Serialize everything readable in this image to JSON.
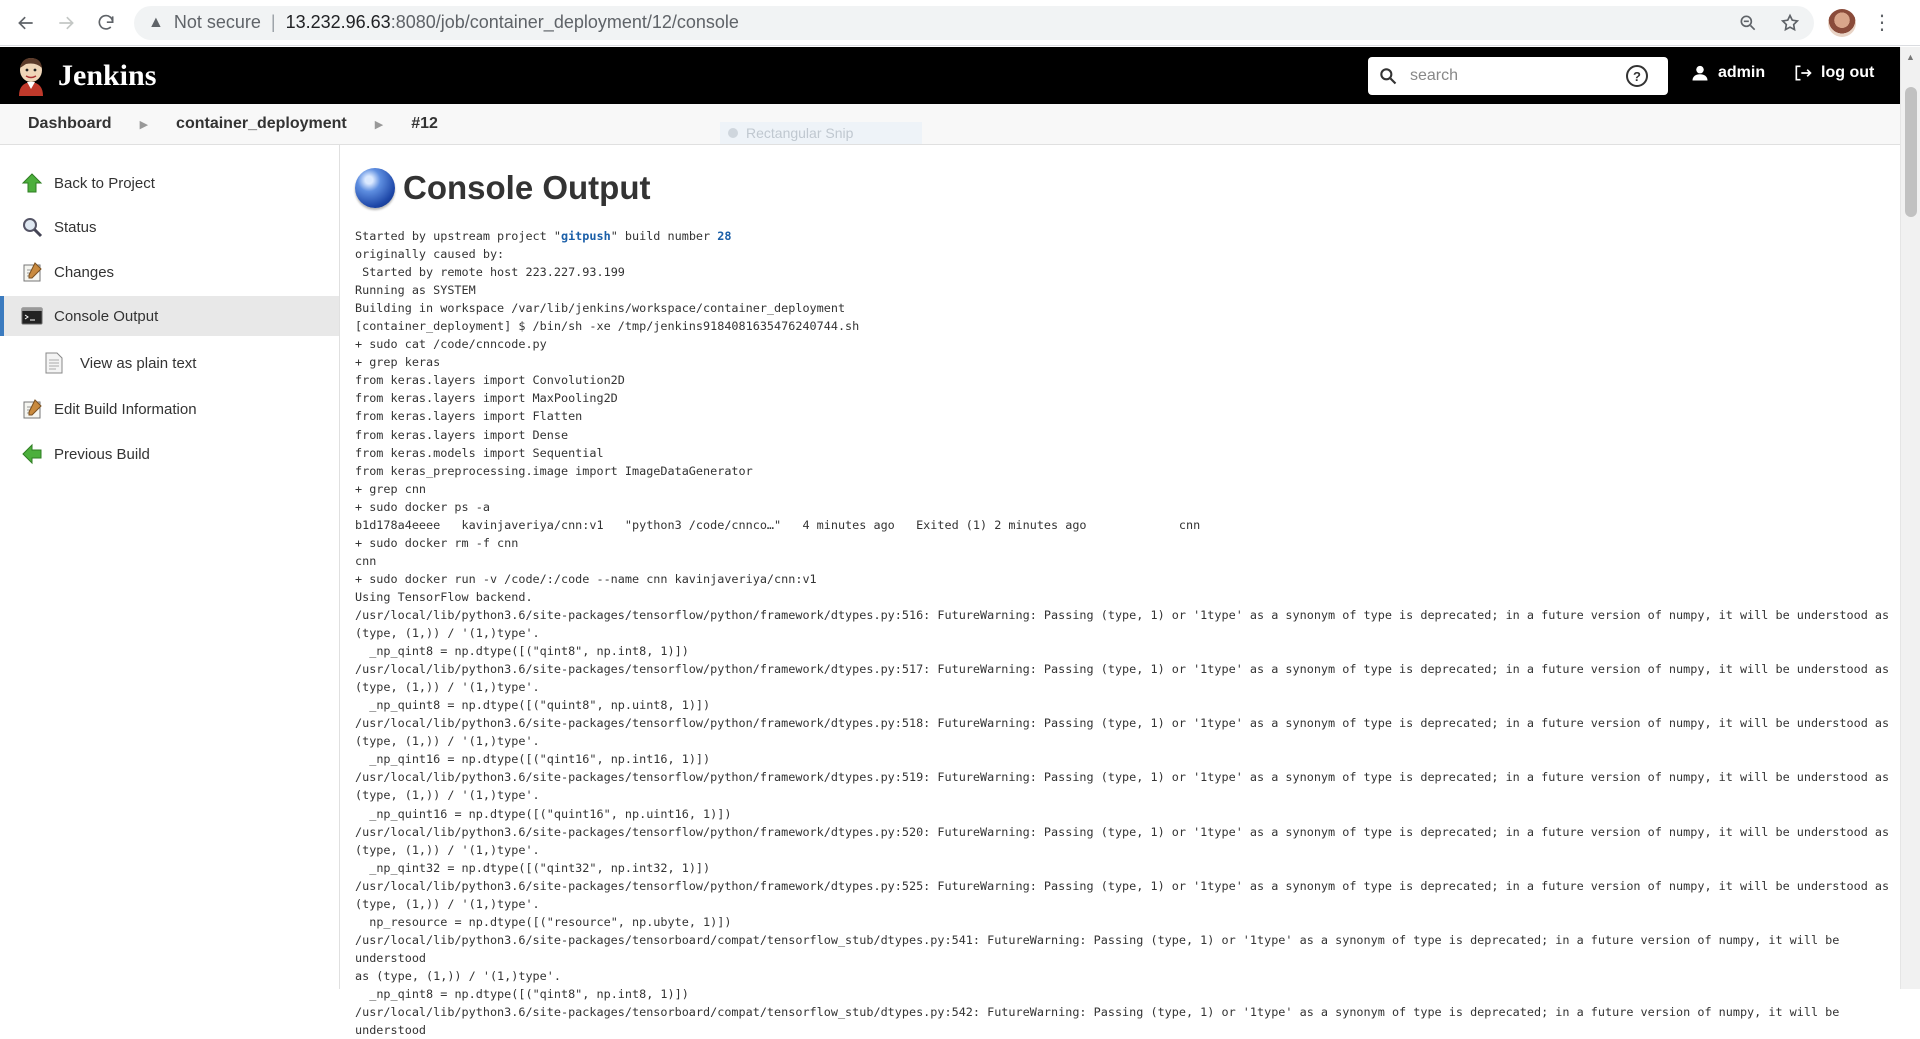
{
  "browser": {
    "security_label": "Not secure",
    "url_host": "13.232.96.63",
    "url_path": ":8080/job/container_deployment/12/console"
  },
  "header": {
    "title": "Jenkins",
    "search_placeholder": "search",
    "help": "?",
    "user": "admin",
    "logout": "log out"
  },
  "breadcrumb": {
    "items": [
      "Dashboard",
      "container_deployment",
      "#12"
    ]
  },
  "snip_overlay": "Rectangular Snip",
  "sidebar": {
    "items": [
      {
        "label": "Back to Project",
        "icon": "arrow-up-icon"
      },
      {
        "label": "Status",
        "icon": "search-icon"
      },
      {
        "label": "Changes",
        "icon": "notepad-icon"
      },
      {
        "label": "Console Output",
        "icon": "terminal-icon"
      },
      {
        "label": "View as plain text",
        "icon": "document-icon"
      },
      {
        "label": "Edit Build Information",
        "icon": "notepad-icon"
      },
      {
        "label": "Previous Build",
        "icon": "arrow-left-icon"
      }
    ]
  },
  "main": {
    "title": "Console Output",
    "first_line": {
      "prefix": "Started by upstream project \"",
      "project": "gitpush",
      "middle": "\" build number ",
      "build": "28"
    },
    "lines": [
      "originally caused by:",
      " Started by remote host 223.227.93.199",
      "Running as SYSTEM",
      "Building in workspace /var/lib/jenkins/workspace/container_deployment",
      "[container_deployment] $ /bin/sh -xe /tmp/jenkins9184081635476240744.sh",
      "+ sudo cat /code/cnncode.py",
      "+ grep keras",
      "from keras.layers import Convolution2D",
      "from keras.layers import MaxPooling2D",
      "from keras.layers import Flatten",
      "from keras.layers import Dense",
      "from keras.models import Sequential",
      "from keras_preprocessing.image import ImageDataGenerator",
      "+ grep cnn",
      "+ sudo docker ps -a",
      "b1d178a4eeee   kavinjaveriya/cnn:v1   \"python3 /code/cnnco…\"   4 minutes ago   Exited (1) 2 minutes ago             cnn",
      "+ sudo docker rm -f cnn",
      "cnn",
      "+ sudo docker run -v /code/:/code --name cnn kavinjaveriya/cnn:v1",
      "Using TensorFlow backend.",
      "/usr/local/lib/python3.6/site-packages/tensorflow/python/framework/dtypes.py:516: FutureWarning: Passing (type, 1) or '1type' as a synonym of type is deprecated; in a future version of numpy, it will be understood as",
      "(type, (1,)) / '(1,)type'.",
      "  _np_qint8 = np.dtype([(\"qint8\", np.int8, 1)])",
      "/usr/local/lib/python3.6/site-packages/tensorflow/python/framework/dtypes.py:517: FutureWarning: Passing (type, 1) or '1type' as a synonym of type is deprecated; in a future version of numpy, it will be understood as",
      "(type, (1,)) / '(1,)type'.",
      "  _np_quint8 = np.dtype([(\"quint8\", np.uint8, 1)])",
      "/usr/local/lib/python3.6/site-packages/tensorflow/python/framework/dtypes.py:518: FutureWarning: Passing (type, 1) or '1type' as a synonym of type is deprecated; in a future version of numpy, it will be understood as",
      "(type, (1,)) / '(1,)type'.",
      "  _np_qint16 = np.dtype([(\"qint16\", np.int16, 1)])",
      "/usr/local/lib/python3.6/site-packages/tensorflow/python/framework/dtypes.py:519: FutureWarning: Passing (type, 1) or '1type' as a synonym of type is deprecated; in a future version of numpy, it will be understood as",
      "(type, (1,)) / '(1,)type'.",
      "  _np_quint16 = np.dtype([(\"quint16\", np.uint16, 1)])",
      "/usr/local/lib/python3.6/site-packages/tensorflow/python/framework/dtypes.py:520: FutureWarning: Passing (type, 1) or '1type' as a synonym of type is deprecated; in a future version of numpy, it will be understood as",
      "(type, (1,)) / '(1,)type'.",
      "  _np_qint32 = np.dtype([(\"qint32\", np.int32, 1)])",
      "/usr/local/lib/python3.6/site-packages/tensorflow/python/framework/dtypes.py:525: FutureWarning: Passing (type, 1) or '1type' as a synonym of type is deprecated; in a future version of numpy, it will be understood as",
      "(type, (1,)) / '(1,)type'.",
      "  np_resource = np.dtype([(\"resource\", np.ubyte, 1)])",
      "/usr/local/lib/python3.6/site-packages/tensorboard/compat/tensorflow_stub/dtypes.py:541: FutureWarning: Passing (type, 1) or '1type' as a synonym of type is deprecated; in a future version of numpy, it will be understood",
      "as (type, (1,)) / '(1,)type'.",
      "  _np_qint8 = np.dtype([(\"qint8\", np.int8, 1)])",
      "/usr/local/lib/python3.6/site-packages/tensorboard/compat/tensorflow_stub/dtypes.py:542: FutureWarning: Passing (type, 1) or '1type' as a synonym of type is deprecated; in a future version of numpy, it will be understood"
    ]
  },
  "colors": {
    "header_bg": "#000000",
    "accent": "#3b7bbf",
    "link": "#1b5fa8"
  }
}
